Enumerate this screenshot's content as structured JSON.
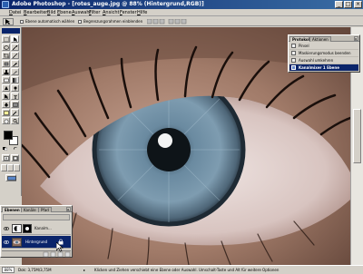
{
  "window": {
    "title": "Adobe Photoshop - [rotes_auge.jpg @ 88% (Hintergrund,RGB)]"
  },
  "menubar": {
    "items": [
      "Datei",
      "Bearbeiten",
      "Bild",
      "Ebene",
      "Auswahl",
      "Filter",
      "Ansicht",
      "Fenster",
      "Hilfe"
    ]
  },
  "options": {
    "auto_select_label": "Ebene automatisch wählen",
    "bbox_label": "Begrenzungsrahmen einblenden"
  },
  "toolbox": {
    "foreground_color": "#000000",
    "background_color": "#ffffff"
  },
  "history_palette": {
    "tabs": [
      "Protokoll",
      "Aktionen"
    ],
    "items": [
      "Pinsel",
      "Maskierungsmodus beenden",
      "Auswahl umkehren",
      "Kanalmixer 1 Ebene"
    ],
    "selected_index": 3
  },
  "layers_palette": {
    "tabs": [
      "Ebenen",
      "Kanäle",
      "Pfad"
    ],
    "layers": [
      {
        "name": "Kanalm..."
      },
      {
        "name": "Hintergrund"
      }
    ],
    "selected_index": 1
  },
  "statusbar": {
    "zoom": "88%",
    "doc_size": "Dok: 3,75M/3,75M",
    "hint": "Klicken und Ziehen verschiebt eine Ebene oder Auswahl. Umschalt-Taste und Alt für weitere Optionen"
  },
  "colors": {
    "titlebar_start": "#0a246a",
    "titlebar_end": "#3a6ea5",
    "chrome": "#d4d0c8",
    "selection": "#0a246a"
  }
}
